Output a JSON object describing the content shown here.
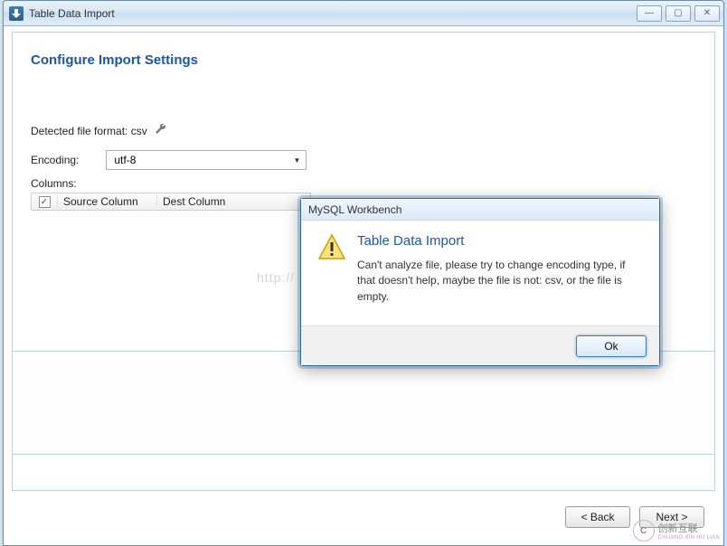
{
  "window": {
    "title": "Table Data Import",
    "minimize_glyph": "—",
    "maximize_glyph": "▢",
    "close_glyph": "✕"
  },
  "page": {
    "heading": "Configure Import Settings",
    "detected_label": "Detected file format: csv",
    "encoding_label": "Encoding:",
    "encoding_value": "utf-8",
    "columns_label": "Columns:",
    "col_source": "Source Column",
    "col_dest": "Dest Column",
    "checkbox_checked": "✓"
  },
  "footer": {
    "back": "< Back",
    "next": "Next >"
  },
  "modal": {
    "title": "MySQL Workbench",
    "heading": "Table Data Import",
    "text": "Can't analyze file, please try to change encoding type, if that doesn't help, maybe the file is not: csv, or the file is empty.",
    "ok": "Ok"
  },
  "watermark": {
    "url": "http://",
    "brand_cn": "创新互联",
    "brand_en": "CHUANG XIN HU LIAN"
  }
}
